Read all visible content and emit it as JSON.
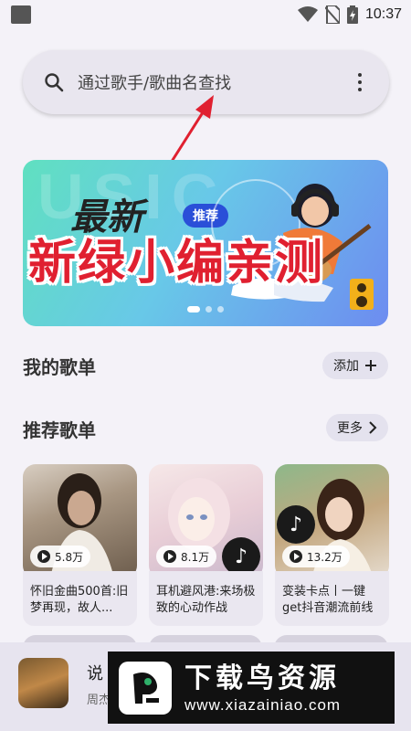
{
  "status_bar": {
    "time": "10:37"
  },
  "search": {
    "placeholder": "通过歌手/歌曲名查找"
  },
  "banner": {
    "bg_text": "USIC",
    "headline": "最新",
    "tag": "推荐",
    "overlay": "新绿小编亲测"
  },
  "my_playlists": {
    "title": "我的歌单",
    "add_label": "添加"
  },
  "recommended": {
    "title": "推荐歌单",
    "more_label": "更多",
    "cards": [
      {
        "plays": "5.8万",
        "title": "怀旧金曲500首:旧梦再现，故人..."
      },
      {
        "plays": "8.1万",
        "title": "耳机避风港:来场极致的心动作战"
      },
      {
        "plays": "13.2万",
        "title": "变装卡点丨一键get抖音潮流前线"
      }
    ]
  },
  "mini_player": {
    "title": "说",
    "subtitle": "周杰"
  },
  "watermark": {
    "title": "下载鸟资源",
    "url": "www.xiazainiao.com"
  },
  "icons": [
    "search-icon",
    "more-vert-icon",
    "plus-icon",
    "chevron-right-icon",
    "play-icon",
    "tiktok-icon",
    "wifi-icon",
    "battery-icon"
  ]
}
